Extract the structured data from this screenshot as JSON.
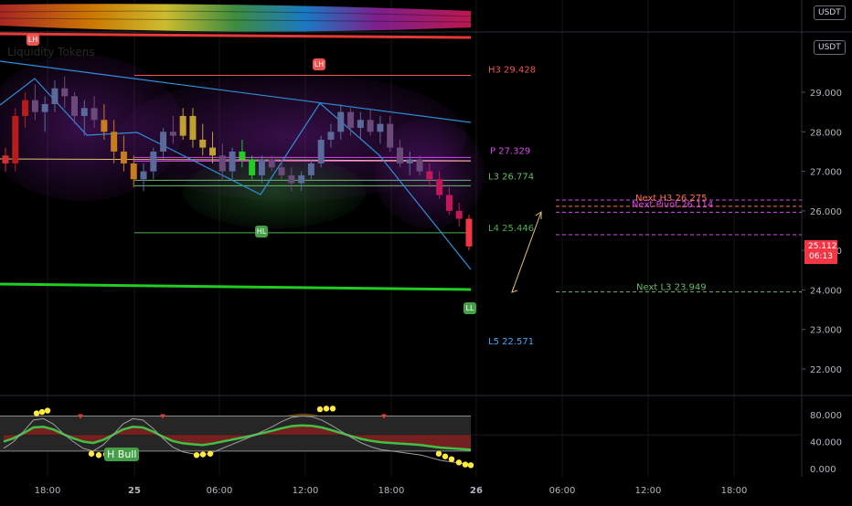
{
  "colors": {
    "background": "#000000",
    "down": "#f23645",
    "up": "#43a047",
    "trendline": "#2f8fd8",
    "h3": "#ef5350",
    "pivot": "#d946ef",
    "l3": "#66bb6a",
    "l4": "#4caf50",
    "l5": "#42a5f5",
    "bright_green": "#22cc22"
  },
  "header": {
    "faded_title": "Liquidity Tokens",
    "currency_tag_top": "USDT",
    "currency_tag_main": "USDT"
  },
  "price_axis": {
    "ticks": [
      "29.000",
      "28.000",
      "27.000",
      "26.000",
      "25.000",
      "24.000",
      "23.000",
      "22.000"
    ],
    "current_price": "25.112",
    "countdown": "06:13"
  },
  "oscillator_axis": {
    "ticks": [
      "80.000",
      "40.000",
      "0.000"
    ]
  },
  "time_axis": {
    "ticks": [
      "18:00",
      "25",
      "06:00",
      "12:00",
      "18:00",
      "26",
      "06:00",
      "12:00",
      "18:00"
    ]
  },
  "pivot_labels": {
    "h3": "H3 29.428",
    "pivot": "P 27.329",
    "l3": "L3 26.774",
    "l4": "L4 25.446",
    "l5": "L5 22.571",
    "next_h3": "Next H3 26.275",
    "next_pivot": "Next Pivot 26.114",
    "next_l3": "Next L3 23.949"
  },
  "markers": {
    "lh_top": "LH",
    "lh_mid": "LH",
    "hl": "HL",
    "ll": "LL",
    "h_bull": "H Bull"
  },
  "chart_data": {
    "type": "candlestick",
    "price_range": [
      21.6,
      30.0
    ],
    "oscillator_range": [
      -5,
      100
    ],
    "levels": {
      "H3": 29.428,
      "P": 27.329,
      "L3": 26.774,
      "L4": 25.446,
      "L5": 22.571,
      "Next H3": 26.275,
      "Next Pivot": 26.114,
      "Next L3": 23.949
    },
    "candles": [
      [
        27.4,
        27.6,
        27.0,
        27.2
      ],
      [
        27.2,
        28.6,
        27.0,
        28.4
      ],
      [
        28.4,
        29.0,
        28.1,
        28.8
      ],
      [
        28.8,
        29.2,
        28.3,
        28.5
      ],
      [
        28.5,
        28.9,
        28.0,
        28.7
      ],
      [
        28.7,
        29.3,
        28.5,
        29.1
      ],
      [
        29.1,
        29.4,
        28.6,
        28.9
      ],
      [
        28.9,
        29.0,
        28.2,
        28.4
      ],
      [
        28.4,
        28.8,
        27.9,
        28.6
      ],
      [
        28.6,
        28.9,
        28.1,
        28.3
      ],
      [
        28.3,
        28.7,
        27.8,
        28.0
      ],
      [
        28.0,
        28.3,
        27.2,
        27.5
      ],
      [
        27.5,
        27.9,
        27.0,
        27.2
      ],
      [
        27.2,
        27.4,
        26.6,
        26.8
      ],
      [
        26.8,
        27.2,
        26.5,
        27.0
      ],
      [
        27.0,
        27.6,
        26.8,
        27.5
      ],
      [
        27.5,
        28.1,
        27.3,
        28.0
      ],
      [
        28.0,
        28.4,
        27.7,
        27.9
      ],
      [
        27.9,
        28.6,
        27.8,
        28.4
      ],
      [
        28.4,
        28.6,
        27.6,
        27.8
      ],
      [
        27.8,
        28.2,
        27.4,
        27.6
      ],
      [
        27.6,
        28.0,
        27.2,
        27.4
      ],
      [
        27.4,
        27.7,
        26.8,
        27.0
      ],
      [
        27.0,
        27.6,
        26.8,
        27.5
      ],
      [
        27.5,
        27.8,
        27.1,
        27.3
      ],
      [
        27.3,
        27.4,
        26.8,
        26.9
      ],
      [
        26.9,
        27.4,
        26.7,
        27.3
      ],
      [
        27.3,
        27.4,
        27.0,
        27.1
      ],
      [
        27.1,
        27.3,
        26.8,
        26.9
      ],
      [
        26.9,
        27.1,
        26.5,
        26.7
      ],
      [
        26.7,
        27.0,
        26.5,
        26.9
      ],
      [
        26.9,
        27.3,
        26.8,
        27.2
      ],
      [
        27.2,
        27.9,
        27.1,
        27.8
      ],
      [
        27.8,
        28.2,
        27.6,
        28.0
      ],
      [
        28.0,
        28.7,
        27.8,
        28.5
      ],
      [
        28.5,
        28.6,
        27.9,
        28.1
      ],
      [
        28.1,
        28.5,
        27.8,
        28.3
      ],
      [
        28.3,
        28.6,
        27.9,
        28.0
      ],
      [
        28.0,
        28.4,
        27.7,
        28.2
      ],
      [
        28.2,
        28.4,
        27.5,
        27.6
      ],
      [
        27.6,
        27.8,
        27.1,
        27.2
      ],
      [
        27.2,
        27.5,
        26.9,
        27.3
      ],
      [
        27.3,
        27.4,
        26.9,
        27.0
      ],
      [
        27.0,
        27.2,
        26.6,
        26.8
      ],
      [
        26.8,
        27.0,
        26.3,
        26.4
      ],
      [
        26.4,
        26.6,
        25.9,
        26.0
      ],
      [
        26.0,
        26.2,
        25.6,
        25.8
      ],
      [
        25.8,
        25.9,
        25.0,
        25.1
      ]
    ],
    "oscillator": [
      30,
      40,
      55,
      72,
      74,
      66,
      52,
      40,
      30,
      26,
      35,
      50,
      66,
      74,
      72,
      60,
      45,
      32,
      25,
      22,
      20,
      24,
      30,
      36,
      42,
      48,
      55,
      62,
      70,
      76,
      78,
      77,
      72,
      64,
      55,
      46,
      38,
      32,
      28,
      26,
      24,
      22,
      20,
      16,
      12,
      10,
      8,
      6
    ]
  }
}
